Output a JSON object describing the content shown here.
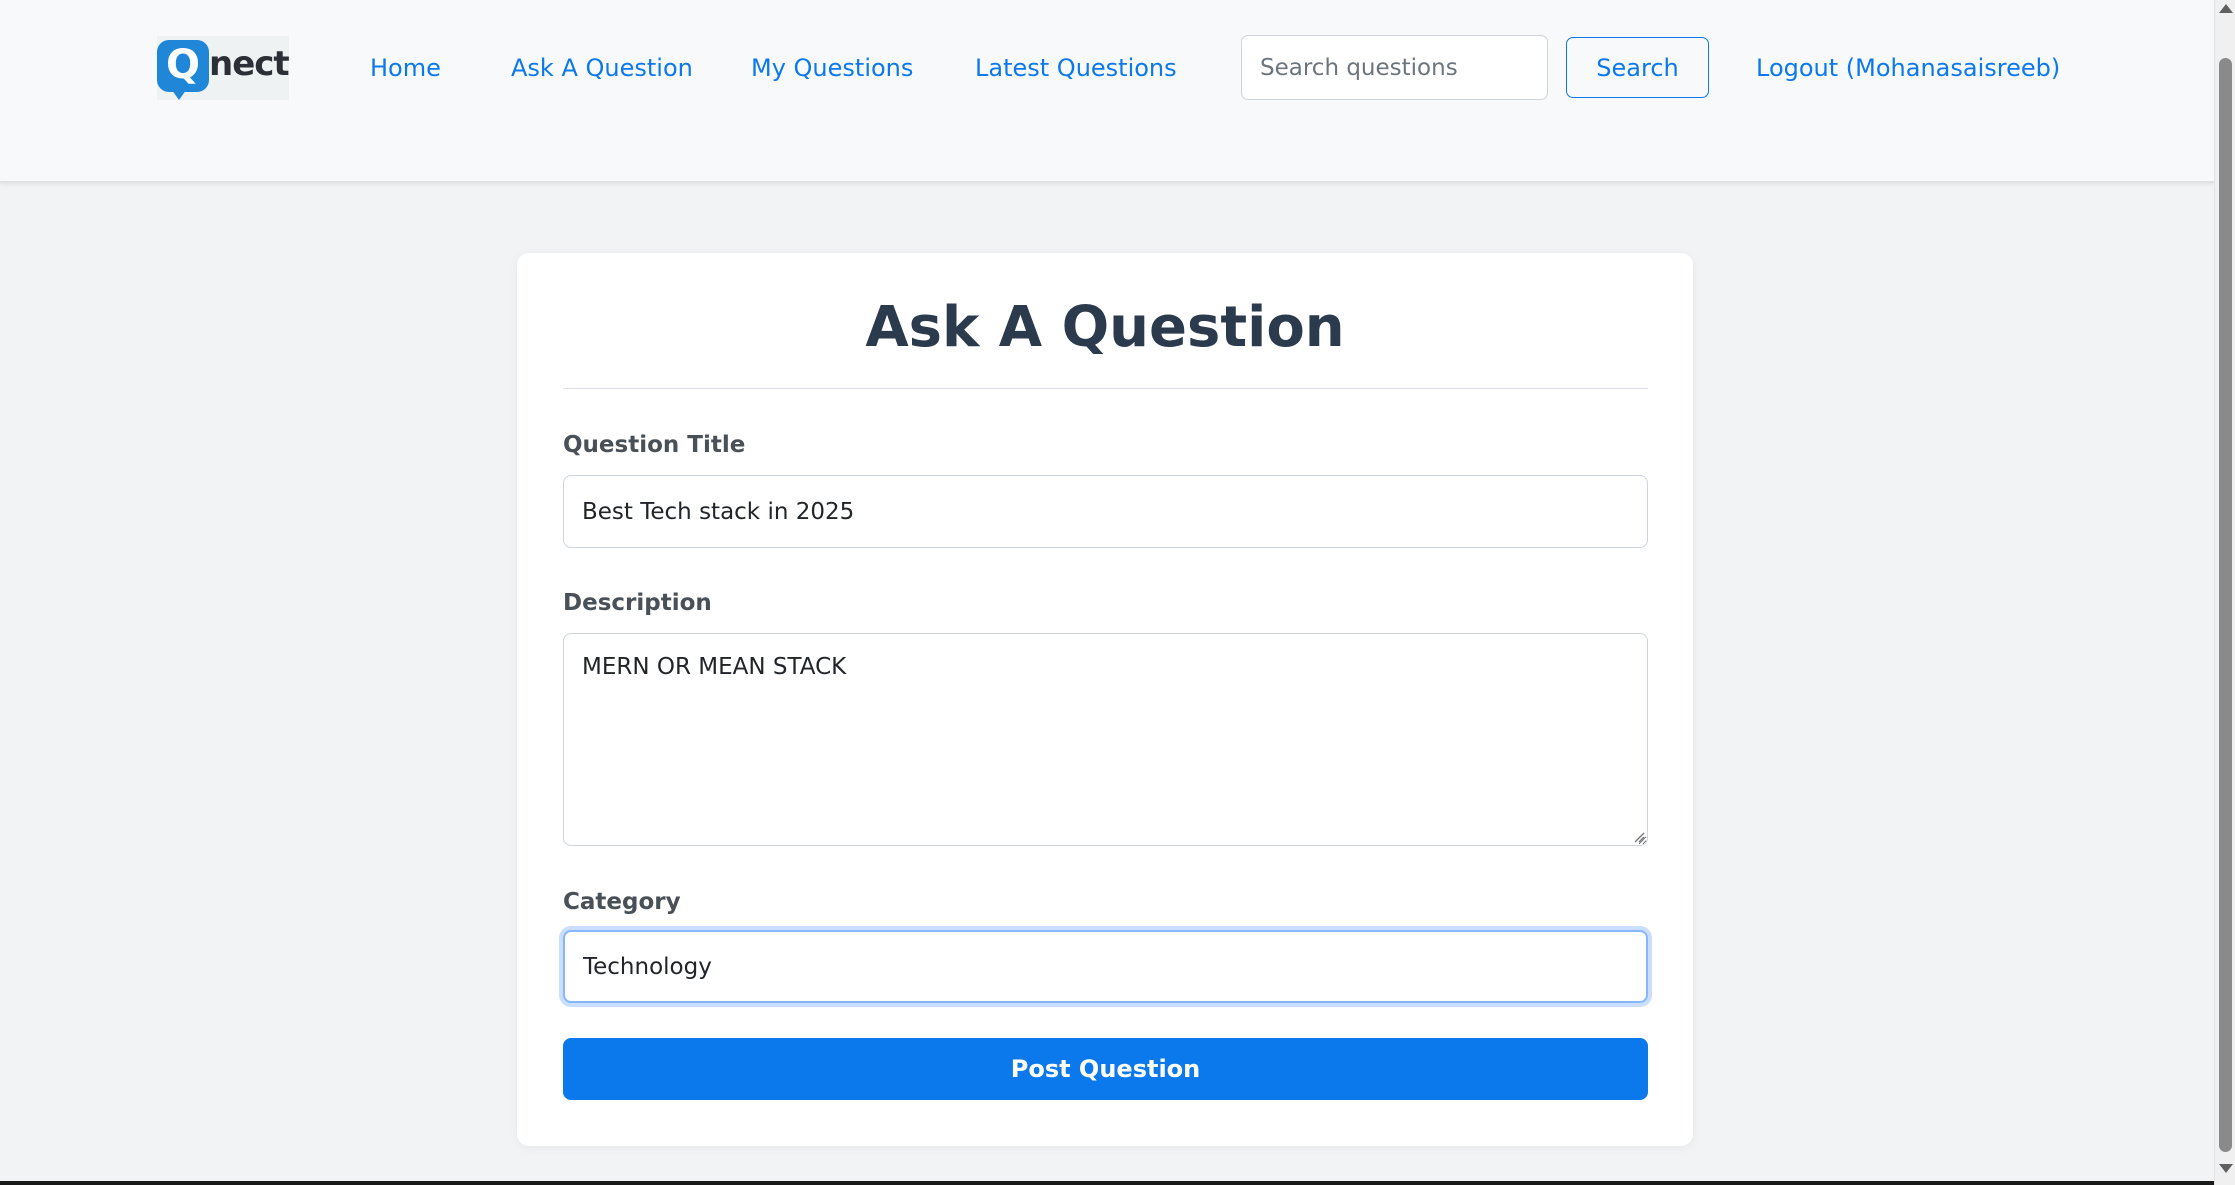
{
  "brand": {
    "logo_letter": "Q",
    "logo_text": "nect",
    "primary_color": "#0b79ec",
    "logo_color": "#1f86d8"
  },
  "nav": {
    "links": [
      {
        "label": "Home"
      },
      {
        "label": "Ask A Question"
      },
      {
        "label": "My Questions"
      },
      {
        "label": "Latest Questions"
      }
    ],
    "search_placeholder": "Search questions",
    "search_value": "",
    "search_button": "Search",
    "logout_label": "Logout (Mohanasaisreeb)"
  },
  "form": {
    "title": "Ask A Question",
    "question_title_label": "Question Title",
    "question_title_value": "Best Tech stack in 2025",
    "description_label": "Description",
    "description_value": "MERN OR MEAN STACK",
    "category_label": "Category",
    "category_value": "Technology",
    "submit_label": "Post Question"
  }
}
